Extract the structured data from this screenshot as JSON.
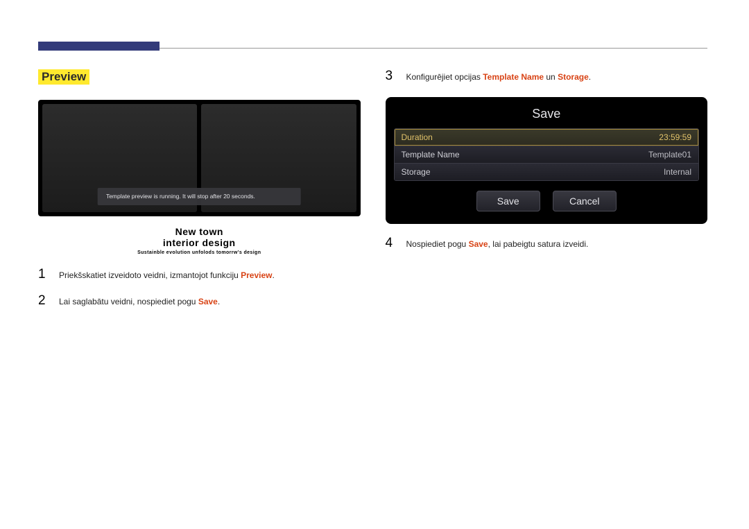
{
  "left": {
    "section_title": "Preview",
    "toast": "Template preview is running. It will stop after 20 seconds.",
    "caption_line1": "New town",
    "caption_line2": "interior design",
    "caption_sub": "Sustainble evolution unfolods tomorrw's design",
    "step1_before": "Priekšskatiet izveidoto veidni, izmantojot funkciju ",
    "step1_hl": "Preview",
    "step1_after": ".",
    "step2_before": "Lai saglabātu veidni, nospiediet pogu ",
    "step2_hl": "Save",
    "step2_after": "."
  },
  "right": {
    "step3_before": "Konfigurējiet opcijas ",
    "step3_hl1": "Template Name",
    "step3_mid": " un ",
    "step3_hl2": "Storage",
    "step3_after": ".",
    "dialog_title": "Save",
    "rows": [
      {
        "label": "Duration",
        "value": "23:59:59"
      },
      {
        "label": "Template Name",
        "value": "Template01"
      },
      {
        "label": "Storage",
        "value": "Internal"
      }
    ],
    "btn_save": "Save",
    "btn_cancel": "Cancel",
    "step4_before": "Nospiediet pogu ",
    "step4_hl": "Save",
    "step4_after": ", lai pabeigtu satura izveidi."
  }
}
